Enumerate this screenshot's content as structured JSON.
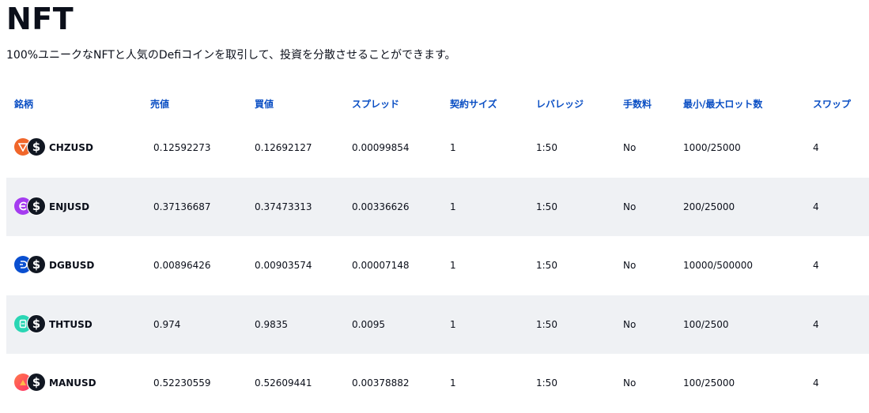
{
  "header": {
    "title": "NFT",
    "subtitle": "100%ユニークなNFTと人気のDefiコインを取引して、投資を分散させることができます。"
  },
  "table": {
    "columns": {
      "name": "銘柄",
      "sell": "売値",
      "buy": "買値",
      "spread": "スプレッド",
      "size": "契約サイズ",
      "leverage": "レバレッジ",
      "fee": "手数料",
      "lot": "最小/最大ロット数",
      "swap": "スワップ"
    },
    "rows": [
      {
        "symbol": "CHZUSD",
        "sell": "0.12592273",
        "buy": "0.12692127",
        "spread": "0.00099854",
        "size": "1",
        "leverage": "1:50",
        "fee": "No",
        "lot": "1000/25000",
        "swap": "4",
        "coin_icon": "chiliz-icon",
        "coin_color": "#f0662a"
      },
      {
        "symbol": "ENJUSD",
        "sell": "0.37136687",
        "buy": "0.37473313",
        "spread": "0.00336626",
        "size": "1",
        "leverage": "1:50",
        "fee": "No",
        "lot": "200/25000",
        "swap": "4",
        "coin_icon": "enjin-icon",
        "coin_color": "#a53cf0"
      },
      {
        "symbol": "DGBUSD",
        "sell": "0.00896426",
        "buy": "0.00903574",
        "spread": "0.00007148",
        "size": "1",
        "leverage": "1:50",
        "fee": "No",
        "lot": "10000/500000",
        "swap": "4",
        "coin_icon": "digibyte-icon",
        "coin_color": "#0a4fd0"
      },
      {
        "symbol": "THTUSD",
        "sell": "0.974",
        "buy": "0.9835",
        "spread": "0.0095",
        "size": "1",
        "leverage": "1:50",
        "fee": "No",
        "lot": "100/2500",
        "swap": "4",
        "coin_icon": "theta-icon",
        "coin_color": "#2ad6b4"
      },
      {
        "symbol": "MANUSD",
        "sell": "0.52230559",
        "buy": "0.52609441",
        "spread": "0.00378882",
        "size": "1",
        "leverage": "1:50",
        "fee": "No",
        "lot": "100/25000",
        "swap": "4",
        "coin_icon": "decentraland-icon",
        "coin_color": "#ff5a52"
      }
    ],
    "quote_icon": "usd-dollar-icon",
    "quote_glyph": "$"
  },
  "colors": {
    "header_text": "#0b4fc4",
    "row_alt_bg": "#eff1f4",
    "title_text": "#0b0f1a"
  }
}
